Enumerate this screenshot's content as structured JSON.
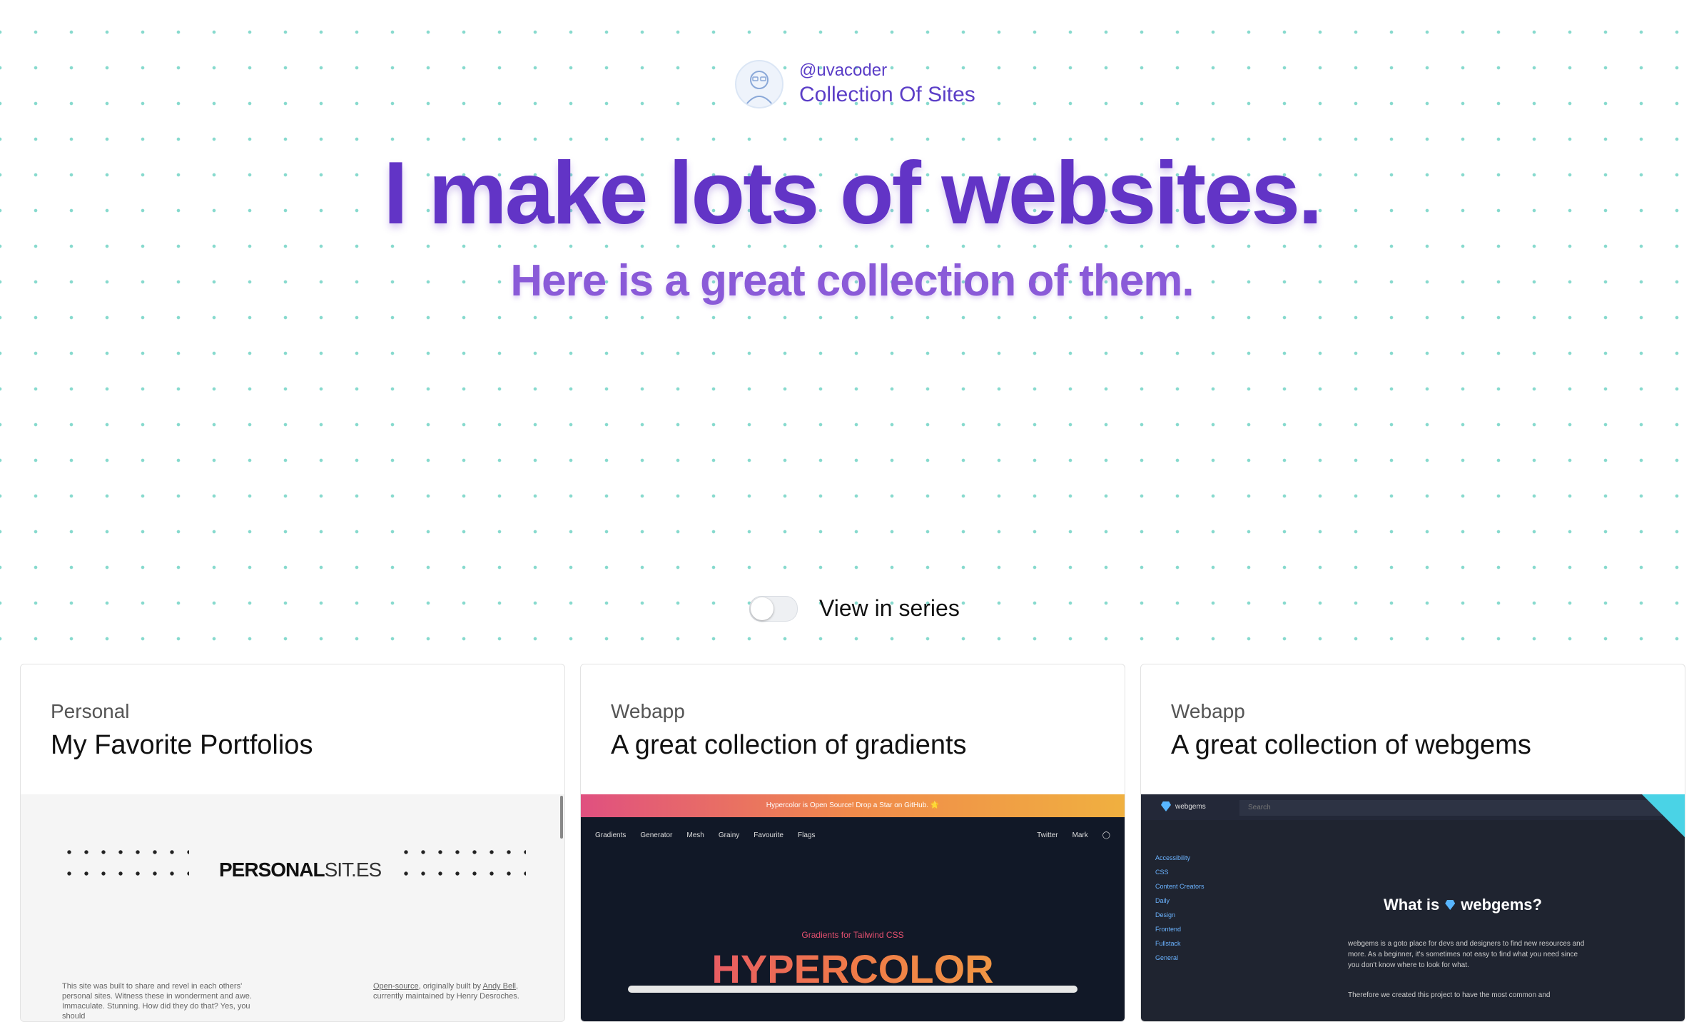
{
  "header": {
    "handle": "@uvacoder",
    "site_name": "Collection Of Sites"
  },
  "hero": {
    "headline": "I make lots of websites.",
    "subhead": "Here is a great collection of them."
  },
  "toggle": {
    "label": "View in series",
    "checked": false
  },
  "cards": [
    {
      "category": "Personal",
      "title": "My Favorite Portfolios",
      "preview": {
        "brand_bold": "PERSONAL",
        "brand_light": "SIT.ES",
        "text_left": "This site was built to share and revel in each others' personal sites. Witness these in wonderment and awe. Immaculate. Stunning. How did they do that? Yes, you should",
        "text_right_link1": "Open-source",
        "text_right_mid": ", originally built by",
        "text_right_link2": "Andy Bell",
        "text_right_tail": "currently maintained by Henry Desroches."
      }
    },
    {
      "category": "Webapp",
      "title": "A great collection of gradients",
      "preview": {
        "banner": "Hypercolor is Open Source! Drop a Star on GitHub. 🌟",
        "nav": [
          "Gradients",
          "Generator",
          "Mesh",
          "Grainy",
          "Favourite",
          "Flags"
        ],
        "nav_right": [
          "Twitter",
          "Mark"
        ],
        "small": "Gradients for Tailwind CSS",
        "big": "HYPERCOLOR"
      }
    },
    {
      "category": "Webapp",
      "title": "A great collection of webgems",
      "preview": {
        "logo": "webgems",
        "search": "Search",
        "side": [
          "Accessibility",
          "CSS",
          "Content Creators",
          "Daily",
          "Design",
          "Frontend",
          "Fullstack",
          "General"
        ],
        "what_pre": "What is",
        "what_post": "webgems?",
        "desc": "webgems is a goto place for devs and designers to find new resources and more. As a beginner, it's sometimes not easy to find what you need since you don't know where to look for what.",
        "desc2": "Therefore we created this project to have the most common and"
      }
    }
  ],
  "colors": {
    "accent": "#6234c6",
    "subhead": "#8a5ad8",
    "dots": "#7ad6c8"
  }
}
